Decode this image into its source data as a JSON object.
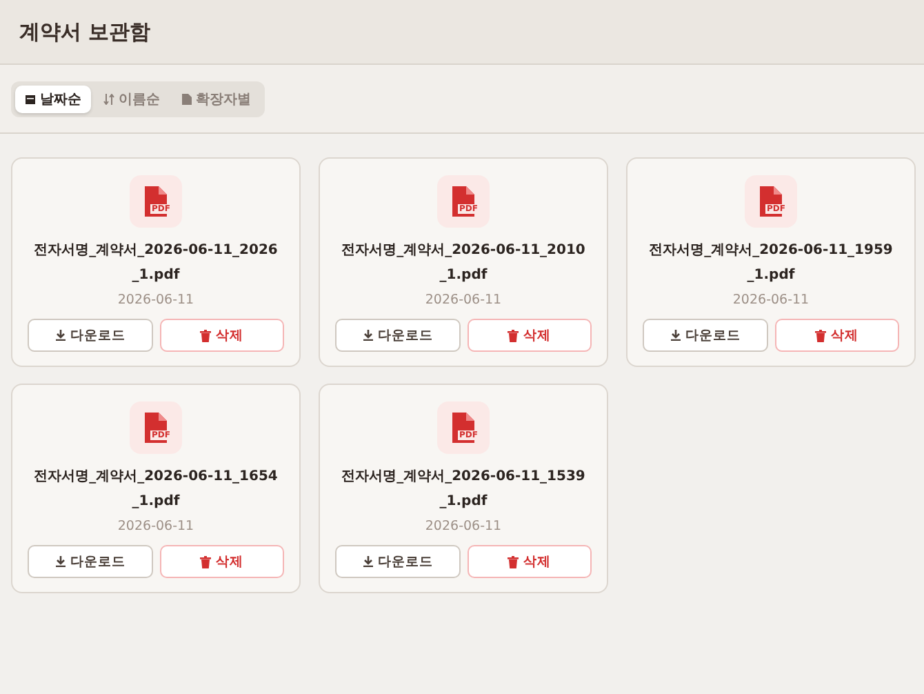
{
  "title": "계약서 보관함",
  "sort_tabs": [
    {
      "label": "날짜순",
      "selected": true
    },
    {
      "label": "이름순",
      "selected": false
    },
    {
      "label": "확장자별",
      "selected": false
    }
  ],
  "files": [
    {
      "icon_label": "PDF",
      "name": "전자서명_계약서_2026-06-11_2026_1.pdf",
      "date": "2026-06-11",
      "download": "다운로드",
      "delete": "삭제"
    },
    {
      "icon_label": "PDF",
      "name": "전자서명_계약서_2026-06-11_2010_1.pdf",
      "date": "2026-06-11",
      "download": "다운로드",
      "delete": "삭제"
    },
    {
      "icon_label": "PDF",
      "name": "전자서명_계약서_2026-06-11_1959_1.pdf",
      "date": "2026-06-11",
      "download": "다운로드",
      "delete": "삭제"
    },
    {
      "icon_label": "PDF",
      "name": "전자서명_계약서_2026-06-11_1654_1.pdf",
      "date": "2026-06-11",
      "download": "다운로드",
      "delete": "삭제"
    },
    {
      "icon_label": "PDF",
      "name": "전자서명_계약서_2026-06-11_1539_1.pdf",
      "date": "2026-06-11",
      "download": "다운로드",
      "delete": "삭제"
    }
  ]
}
